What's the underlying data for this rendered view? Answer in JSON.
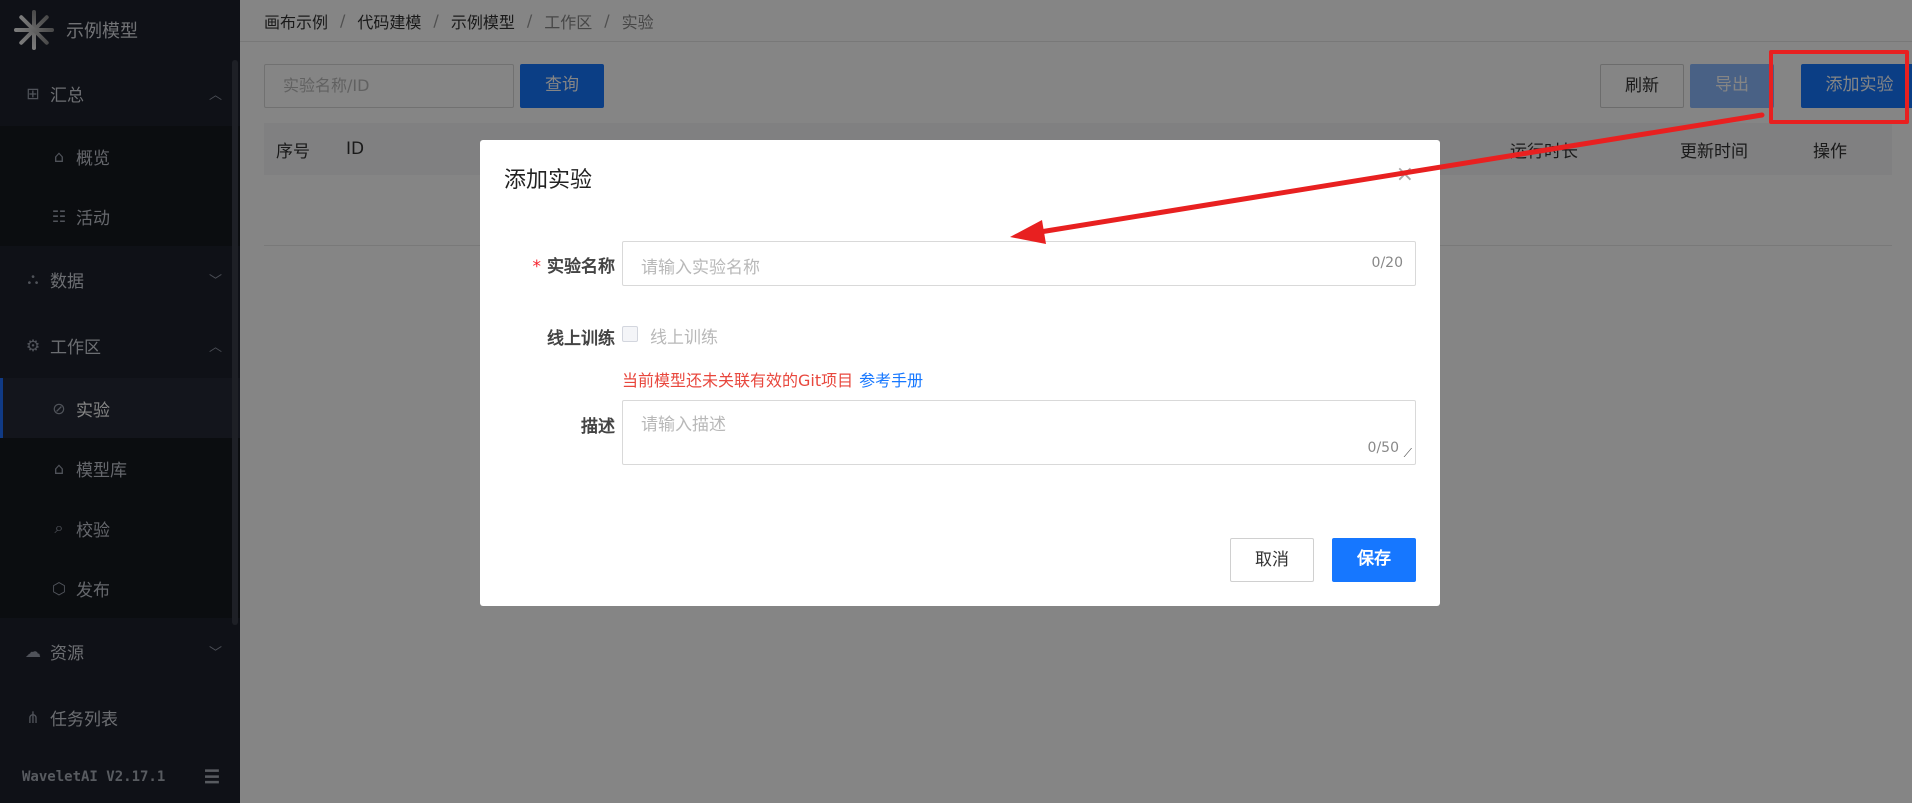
{
  "app": {
    "name": "示例模型",
    "version": "WaveletAI V2.17.1"
  },
  "sidebar": {
    "groups": [
      {
        "label": "汇总",
        "icon": "grid-icon"
      },
      {
        "label": "数据",
        "icon": "hierarchy-icon"
      },
      {
        "label": "工作区",
        "icon": "chip-icon"
      },
      {
        "label": "资源",
        "icon": "cloud-icon"
      },
      {
        "label": "任务列表",
        "icon": "share-icon"
      }
    ],
    "summary_items": [
      {
        "label": "概览",
        "icon": "home-icon"
      },
      {
        "label": "活动",
        "icon": "list-icon"
      }
    ],
    "workspace_items": [
      {
        "label": "实验",
        "icon": "experiment-icon"
      },
      {
        "label": "模型库",
        "icon": "warehouse-icon"
      },
      {
        "label": "校验",
        "icon": "scan-icon"
      },
      {
        "label": "发布",
        "icon": "box-icon"
      }
    ]
  },
  "breadcrumb": [
    "画布示例",
    "代码建模",
    "示例模型",
    "工作区",
    "实验"
  ],
  "toolbar": {
    "search_placeholder": "实验名称/ID",
    "query": "查询",
    "refresh": "刷新",
    "export": "导出",
    "add": "添加实验"
  },
  "table": {
    "columns": [
      "序号",
      "ID",
      "运行时长",
      "更新时间",
      "操作"
    ]
  },
  "dialog": {
    "title": "添加实验",
    "name_label": "实验名称",
    "name_placeholder": "请输入实验名称",
    "name_count": "0/20",
    "online_label": "线上训练",
    "online_checkbox_label": "线上训练",
    "warning": "当前模型还未关联有效的Git项目",
    "manual_link": "参考手册",
    "desc_label": "描述",
    "desc_placeholder": "请输入描述",
    "desc_count": "0/50",
    "cancel": "取消",
    "save": "保存"
  },
  "colors": {
    "primary": "#1677ff",
    "annotation": "#e82020",
    "sidebar_bg": "#1e222d"
  }
}
